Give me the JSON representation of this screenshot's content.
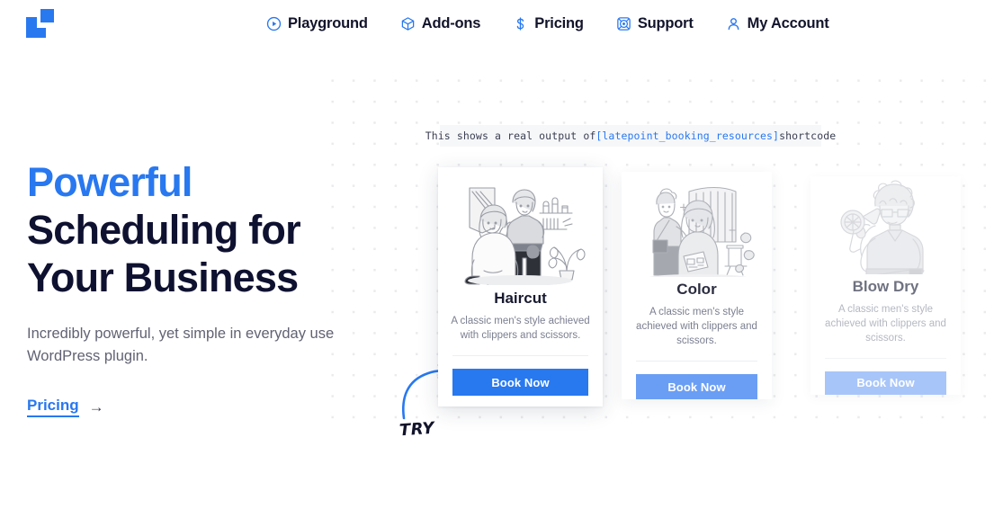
{
  "brand": {
    "logo_name": "latepoint-logo",
    "accent": "#2878f0",
    "dark": "#0f1130"
  },
  "header": {
    "nav": [
      {
        "label": "Playground",
        "icon": "play-circle-icon"
      },
      {
        "label": "Add-ons",
        "icon": "cube-icon"
      },
      {
        "label": "Pricing",
        "icon": "dollar-icon"
      },
      {
        "label": "Support",
        "icon": "lifebuoy-icon"
      },
      {
        "label": "My Account",
        "icon": "user-icon"
      }
    ]
  },
  "hero": {
    "headline_line1": "Powerful",
    "headline_line2": "Scheduling for",
    "headline_line3": "Your Business",
    "subtitle": "Incredibly powerful, yet simple in everyday use WordPress plugin.",
    "cta_label": "Pricing",
    "cta_arrow": "→"
  },
  "shortcode_banner": {
    "prefix": "This shows a real output of ",
    "code": "[latepoint_booking_resources]",
    "suffix": " shortcode"
  },
  "annotation": {
    "label": "TRY",
    "arrow_icon": "curved-arrow-icon"
  },
  "cards": [
    {
      "title": "Haircut",
      "description": "A classic men's style achieved with clippers and scissors.",
      "button_label": "Book Now",
      "button_color": "#2878f0",
      "illustration": "barber-cutting-hair-illustration"
    },
    {
      "title": "Color",
      "description": "A classic men's style achieved with clippers and scissors.",
      "button_label": "Book Now",
      "button_color": "#6a9ef5",
      "illustration": "hair-coloring-salon-illustration"
    },
    {
      "title": "Blow Dry",
      "description": "A classic men's style achieved with clippers and scissors.",
      "button_label": "Book Now",
      "button_color": "#a8c5f9",
      "illustration": "stylist-with-blow-dryer-illustration"
    }
  ]
}
